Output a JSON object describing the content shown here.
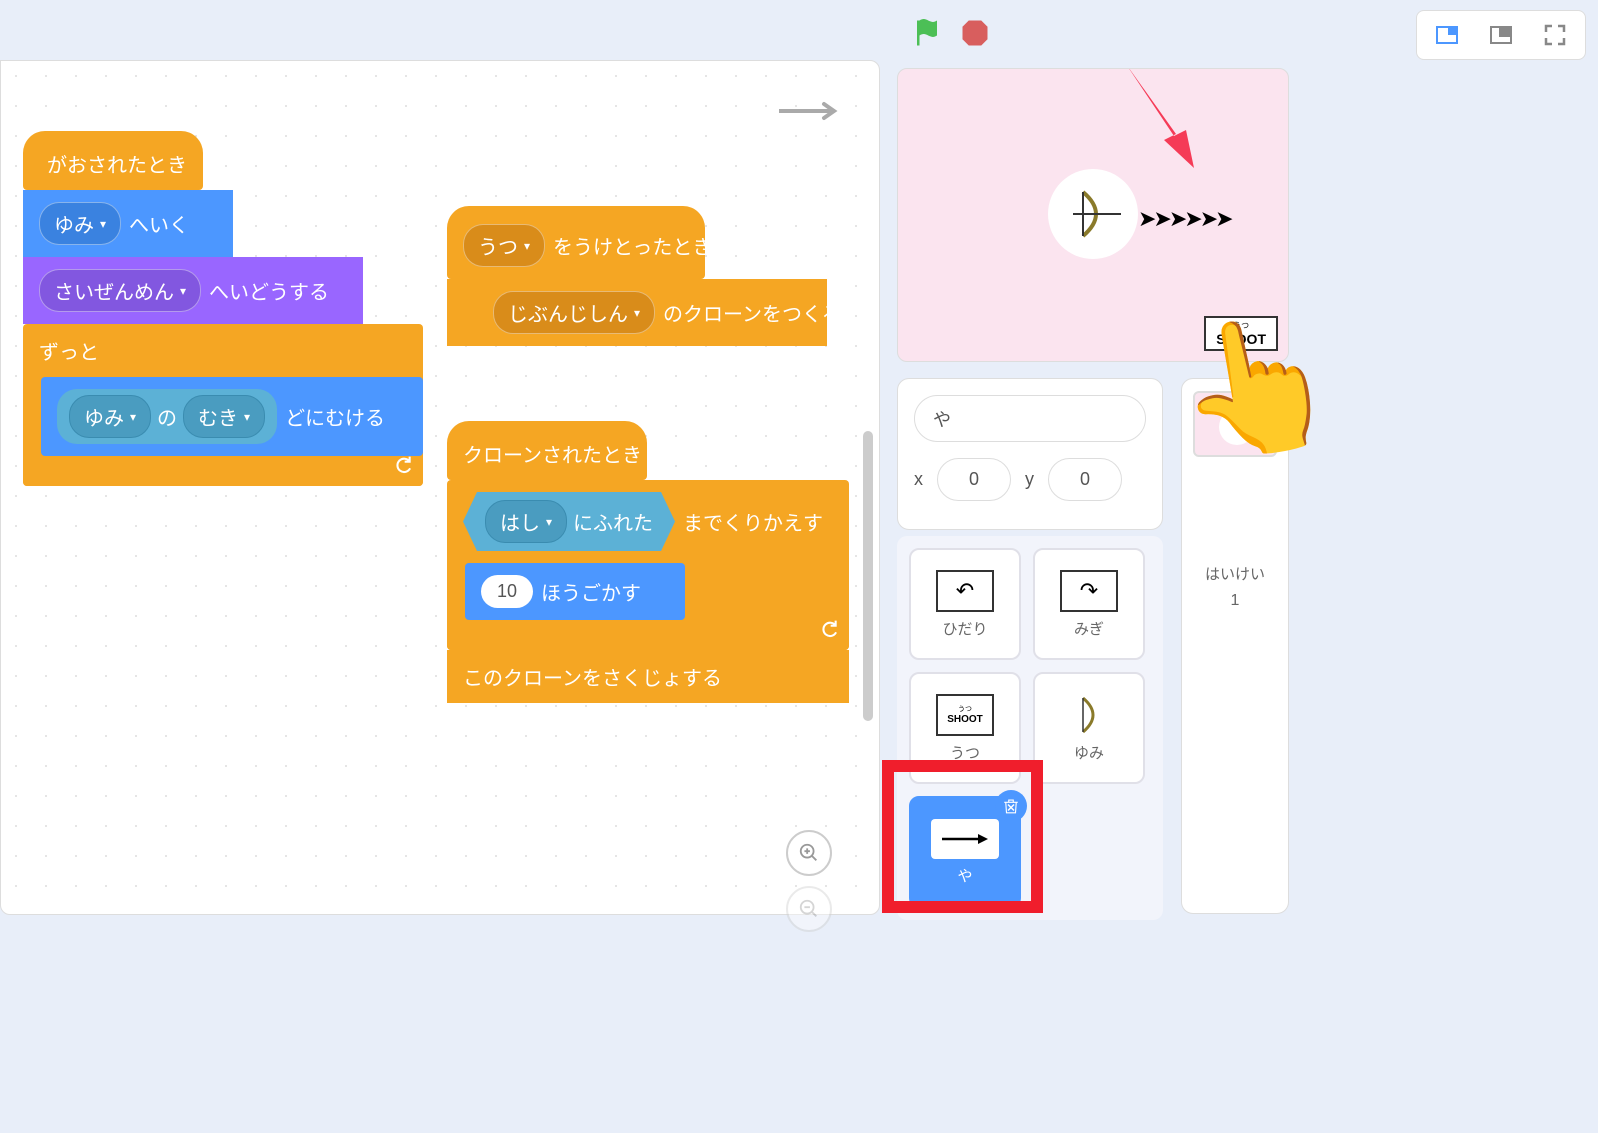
{
  "scripts": {
    "stack1": {
      "hat": "がおされたとき",
      "goto_target": "ゆみ",
      "goto_suffix": "へいく",
      "layer_target": "さいぜんめん",
      "layer_suffix": "へいどうする",
      "forever": "ずっと",
      "point_target": "ゆみ",
      "point_of": "の",
      "point_prop": "むき",
      "point_suffix": "どにむける"
    },
    "stack2": {
      "recv_target": "うつ",
      "recv_suffix": "をうけとったとき",
      "clone_target": "じぶんじしん",
      "clone_suffix": "のクローンをつくる"
    },
    "stack3": {
      "hat": "クローンされたとき",
      "repeat_prefix": "までくりかえす",
      "touch_target": "はし",
      "touch_suffix": "にふれた",
      "move_steps": "10",
      "move_suffix": "ほうごかす",
      "delete_clone": "このクローンをさくじょする"
    }
  },
  "stage_buttons": {
    "shoot_tiny": "うつ",
    "shoot_big": "SHOOT"
  },
  "sprite_info": {
    "name": "や",
    "x_label": "x",
    "x_value": "0",
    "y_label": "y",
    "y_value": "0"
  },
  "sprites": {
    "hidari": "ひだり",
    "migi": "みぎ",
    "utsu": "うつ",
    "utsu_sub": "うつ",
    "utsu_thumb": "SHOOT",
    "yumi": "ゆみ",
    "ya": "や"
  },
  "backdrop": {
    "label": "はいけい",
    "count": "1"
  }
}
